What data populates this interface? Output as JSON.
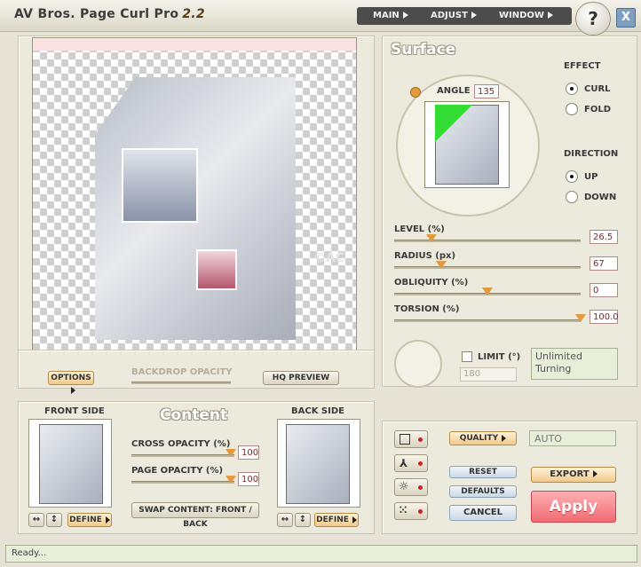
{
  "window": {
    "title": "AV Bros. Page Curl Pro",
    "version": "2.2",
    "menu": [
      "MAIN",
      "ADJUST",
      "WINDOW"
    ],
    "help_label": "?",
    "close_label": "X"
  },
  "canvas": {
    "watermark": "©AC",
    "options_label": "OPTIONS",
    "backdrop_opacity_label": "BACKDROP OPACITY",
    "hq_preview_label": "HQ PREVIEW"
  },
  "surface": {
    "heading": "Surface",
    "angle_label": "ANGLE",
    "angle_value": "135",
    "effect_label": "EFFECT",
    "effect_options": [
      "CURL",
      "FOLD"
    ],
    "effect_selected": "CURL",
    "direction_label": "DIRECTION",
    "direction_options": [
      "UP",
      "DOWN"
    ],
    "direction_selected": "UP",
    "sliders": [
      {
        "label": "LEVEL (%)",
        "value": "26.5",
        "fraction": 0.2
      },
      {
        "label": "RADIUS (px)",
        "value": "67",
        "fraction": 0.25
      },
      {
        "label": "OBLIQUITY (%)",
        "value": "0",
        "fraction": 0.5
      },
      {
        "label": "TORSION (%)",
        "value": "100.0",
        "fraction": 1.0
      }
    ],
    "limit_label": "LIMIT (°)",
    "limit_value": "180",
    "limit_checked": false,
    "info_text": "Unlimited Turning"
  },
  "content": {
    "heading": "Content",
    "front_label": "FRONT SIDE",
    "back_label": "BACK SIDE",
    "define_label": "DEFINE",
    "cross_opacity_label": "CROSS OPACITY (%)",
    "cross_opacity_value": "100",
    "page_opacity_label": "PAGE OPACITY (%)",
    "page_opacity_value": "100",
    "swap_label": "SWAP CONTENT: FRONT / BACK"
  },
  "actions": {
    "quality_label": "QUALITY",
    "quality_value": "AUTO",
    "reset_label": "RESET",
    "defaults_label": "DEFAULTS",
    "cancel_label": "CANCEL",
    "export_label": "EXPORT",
    "apply_label": "Apply"
  },
  "status": {
    "text": "Ready..."
  },
  "colors": {
    "accent": "#f06b72",
    "slider_thumb": "#e29a3c",
    "preview_green": "#33dd33"
  }
}
